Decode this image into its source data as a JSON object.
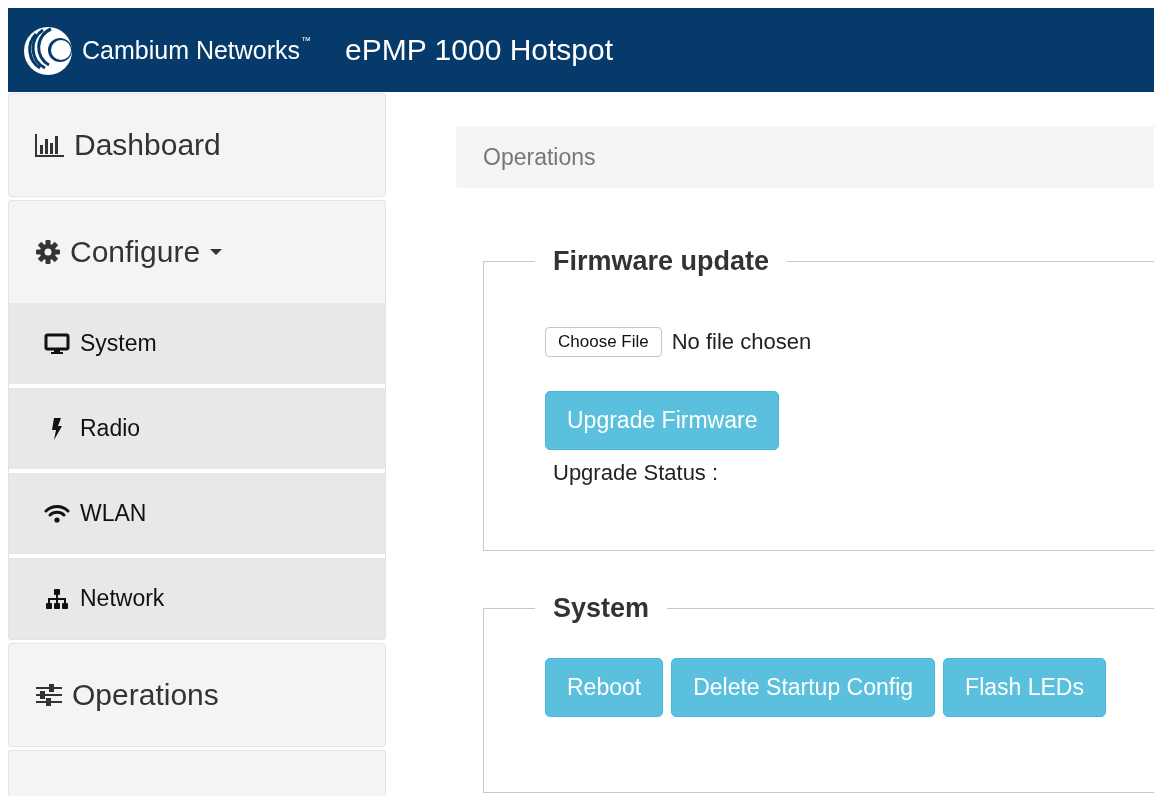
{
  "header": {
    "brand": "Cambium Networks",
    "trademark": "™",
    "title": "ePMP 1000 Hotspot"
  },
  "sidebar": {
    "items": [
      {
        "label": "Dashboard"
      },
      {
        "label": "Configure",
        "expanded": true,
        "children": [
          {
            "label": "System"
          },
          {
            "label": "Radio"
          },
          {
            "label": "WLAN"
          },
          {
            "label": "Network"
          }
        ]
      },
      {
        "label": "Operations"
      }
    ]
  },
  "breadcrumb": "Operations",
  "sections": [
    {
      "legend": "Firmware update",
      "file_input": {
        "button": "Choose File",
        "status": "No file chosen"
      },
      "buttons": [
        "Upgrade Firmware"
      ],
      "status_label": "Upgrade Status :"
    },
    {
      "legend": "System",
      "buttons": [
        "Reboot",
        "Delete Startup Config",
        "Flash LEDs"
      ]
    }
  ]
}
